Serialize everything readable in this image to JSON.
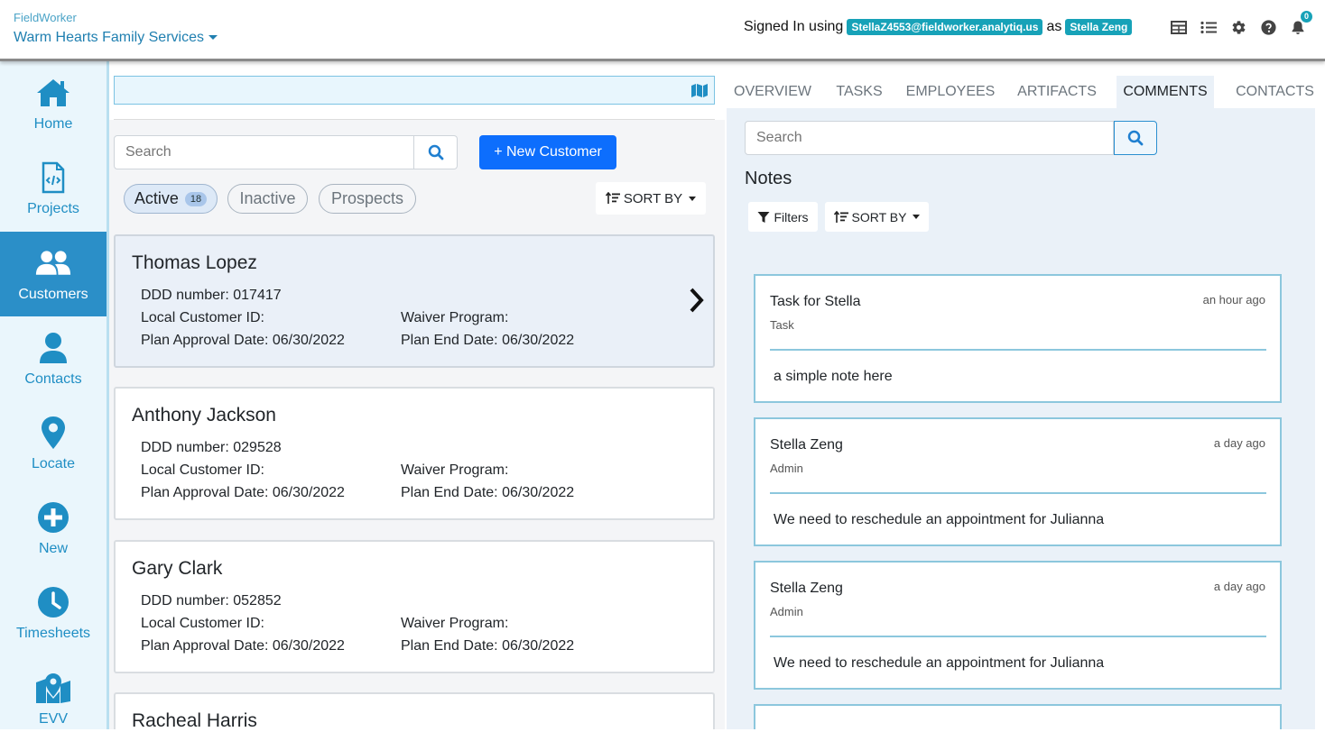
{
  "header": {
    "app_name": "FieldWorker",
    "org_name": "Warm Hearts Family Services",
    "signed_in_prefix": "Signed In using",
    "email": "StellaZ4553@fieldworker.analytiq.us",
    "as_text": "as",
    "user_name": "Stella Zeng",
    "notification_count": "0",
    "icons": [
      "table-icon",
      "list-icon",
      "gear-icon",
      "help-icon",
      "bell-icon"
    ]
  },
  "sidebar": {
    "items": [
      {
        "label": "Home",
        "icon": "home-icon"
      },
      {
        "label": "Projects",
        "icon": "code-file-icon"
      },
      {
        "label": "Customers",
        "icon": "users-icon",
        "active": true
      },
      {
        "label": "Contacts",
        "icon": "user-icon"
      },
      {
        "label": "Locate",
        "icon": "map-marker-icon"
      },
      {
        "label": "New",
        "icon": "plus-circle-icon"
      },
      {
        "label": "Timesheets",
        "icon": "clock-icon"
      },
      {
        "label": "EVV",
        "icon": "map-location-icon"
      }
    ]
  },
  "customers": {
    "search_placeholder": "Search",
    "new_button": "+ New Customer",
    "filters": [
      {
        "label": "Active",
        "count": "18",
        "active": true
      },
      {
        "label": "Inactive"
      },
      {
        "label": "Prospects"
      }
    ],
    "sort_label": "SORT BY",
    "list": [
      {
        "name": "Thomas Lopez",
        "ddd": "DDD number: 017417",
        "local_id": "Local Customer ID:",
        "waiver": "Waiver Program:",
        "approval": "Plan Approval Date: 06/30/2022",
        "end": "Plan End Date: 06/30/2022"
      },
      {
        "name": "Anthony Jackson",
        "ddd": "DDD number: 029528",
        "local_id": "Local Customer ID:",
        "waiver": "Waiver Program:",
        "approval": "Plan Approval Date: 06/30/2022",
        "end": "Plan End Date: 06/30/2022"
      },
      {
        "name": "Gary Clark",
        "ddd": "DDD number: 052852",
        "local_id": "Local Customer ID:",
        "waiver": "Waiver Program:",
        "approval": "Plan Approval Date: 06/30/2022",
        "end": "Plan End Date: 06/30/2022"
      },
      {
        "name": "Racheal Harris"
      }
    ]
  },
  "detail": {
    "tabs": [
      "OVERVIEW",
      "TASKS",
      "EMPLOYEES",
      "ARTIFACTS",
      "COMMENTS",
      "CONTACTS"
    ],
    "active_tab": "COMMENTS",
    "search_placeholder": "Search",
    "notes_title": "Notes",
    "filters_label": "Filters",
    "sort_label": "SORT BY",
    "notes": [
      {
        "title": "Task for Stella",
        "role": "Task",
        "time": "an hour ago",
        "body": "a simple note here"
      },
      {
        "title": "Stella Zeng",
        "role": "Admin",
        "time": "a day ago",
        "body": "We need to reschedule an appointment for Julianna"
      },
      {
        "title": "Stella Zeng",
        "role": "Admin",
        "time": "a day ago",
        "body": "We need to reschedule an appointment for Julianna"
      }
    ]
  },
  "colors": {
    "primary": "#0d6efd",
    "sidebar_active": "#2b8fc8",
    "sidebar_bg": "#eaf6fc",
    "badge": "#17a2b8",
    "note_border": "#8cc7dd"
  }
}
